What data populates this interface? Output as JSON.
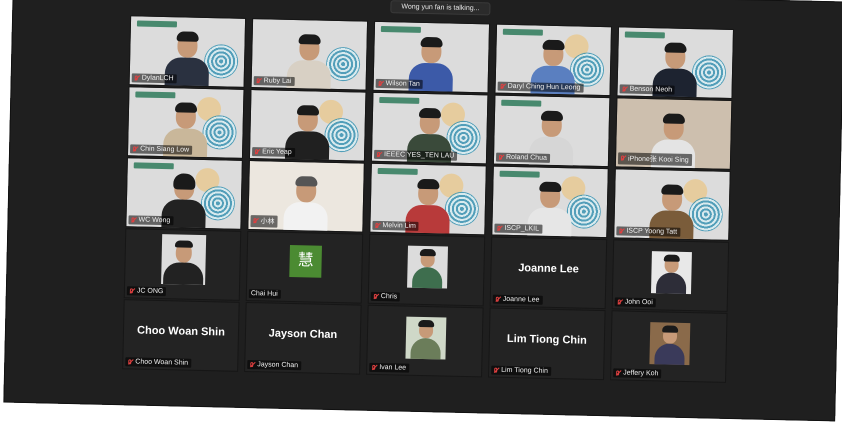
{
  "meeting": {
    "speaking_banner": "Wong yun fan is talking..."
  },
  "participants": [
    {
      "name": "DylanLCH",
      "kind": "video"
    },
    {
      "name": "Ruby Lai",
      "kind": "video"
    },
    {
      "name": "Wilson Tan",
      "kind": "video"
    },
    {
      "name": "Daryl Ching Hun Leong",
      "kind": "video"
    },
    {
      "name": "Benson Neoh",
      "kind": "video"
    },
    {
      "name": "Chin Siang Low",
      "kind": "video"
    },
    {
      "name": "Eric Yeap",
      "kind": "video"
    },
    {
      "name": "IEEEC YES_TEN LAU",
      "kind": "video"
    },
    {
      "name": "Roland Chua",
      "kind": "video"
    },
    {
      "name": "iPhone张 Kooi Sing",
      "kind": "video"
    },
    {
      "name": "WC Wong",
      "kind": "video"
    },
    {
      "name": "小林",
      "kind": "video"
    },
    {
      "name": "Melvin Lim",
      "kind": "video"
    },
    {
      "name": "ISCP_LKIL",
      "kind": "video"
    },
    {
      "name": "ISCP Yoong Tatt",
      "kind": "video"
    },
    {
      "name": "JC ONG",
      "kind": "photo"
    },
    {
      "name": "Chai Hui",
      "kind": "avatar",
      "avatar_text": "慧"
    },
    {
      "name": "Chris",
      "kind": "photo"
    },
    {
      "name": "Joanne Lee",
      "kind": "name",
      "display": "Joanne Lee"
    },
    {
      "name": "John Ooi",
      "kind": "photo"
    },
    {
      "name": "Choo Woan Shin",
      "kind": "name",
      "display": "Choo Woan Shin"
    },
    {
      "name": "Jayson Chan",
      "kind": "name",
      "display": "Jayson Chan"
    },
    {
      "name": "Ivan Lee",
      "kind": "photo"
    },
    {
      "name": "Lim Tiong Chin",
      "kind": "name",
      "display": "Lim Tiong Chin"
    },
    {
      "name": "Jeffery Koh",
      "kind": "photo"
    }
  ],
  "colors": {
    "muted_mic": "#e04040",
    "tile_bg": "#232323",
    "avatar_bg": "#4b8b32"
  }
}
